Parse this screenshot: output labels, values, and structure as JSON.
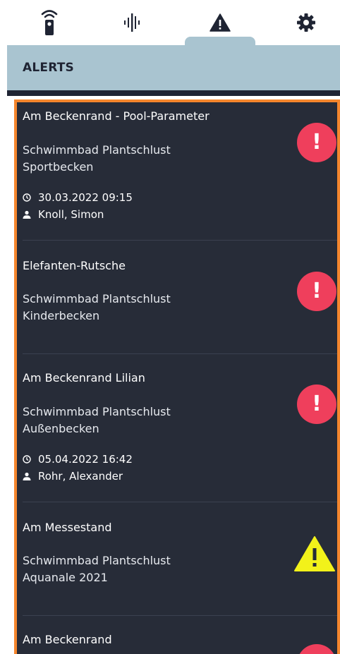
{
  "tabs": [
    {
      "icon": "remote-icon"
    },
    {
      "icon": "waveform-icon"
    },
    {
      "icon": "warning-icon"
    },
    {
      "icon": "gear-icon"
    }
  ],
  "header": {
    "title": "ALERTS"
  },
  "colors": {
    "header_bg": "#a9c4d0",
    "list_bg": "#272c38",
    "frame": "#f5862d",
    "critical": "#ef3f5c",
    "warning": "#f2f21a"
  },
  "alerts": [
    {
      "title": "Am Beckenrand - Pool-Parameter",
      "location": "Schwimmbad Plantschlust",
      "pool": "Sportbecken",
      "datetime": "30.03.2022 09:15",
      "person": "Knoll, Simon",
      "severity": "critical",
      "badge_symbol": "!"
    },
    {
      "title": "Elefanten-Rutsche",
      "location": "Schwimmbad Plantschlust",
      "pool": "Kinderbecken",
      "severity": "critical",
      "badge_symbol": "!"
    },
    {
      "title": "Am Beckenrand Lilian",
      "location": "Schwimmbad Plantschlust",
      "pool": "Außenbecken",
      "datetime": "05.04.2022 16:42",
      "person": "Rohr, Alexander",
      "severity": "critical",
      "badge_symbol": "!"
    },
    {
      "title": "Am Messestand",
      "location": "Schwimmbad Plantschlust",
      "pool": "Aquanale 2021",
      "severity": "warning",
      "badge_symbol": "!"
    },
    {
      "title": "Am Beckenrand",
      "severity": "critical"
    }
  ]
}
